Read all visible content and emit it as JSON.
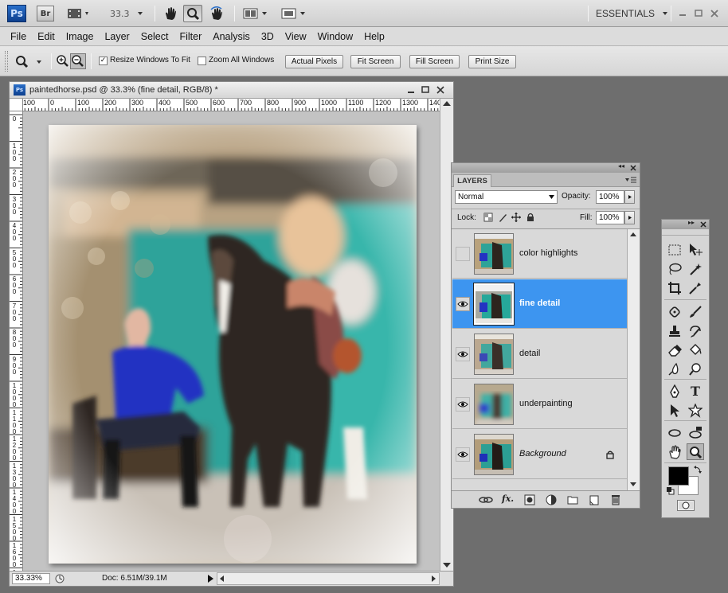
{
  "app": {
    "logo": "Ps",
    "bridge": "Br",
    "zoom_value": "33.3",
    "workspace": "ESSENTIALS",
    "icons": [
      "minimize-icon",
      "maximize-icon",
      "close-icon"
    ]
  },
  "menu": [
    "File",
    "Edit",
    "Image",
    "Layer",
    "Select",
    "Filter",
    "Analysis",
    "3D",
    "View",
    "Window",
    "Help"
  ],
  "options": {
    "resize_label": "Resize Windows To Fit",
    "zoom_all_label": "Zoom All Windows",
    "actual_pixels": "Actual Pixels",
    "fit_screen": "Fit Screen",
    "fill_screen": "Fill Screen",
    "print_size": "Print Size"
  },
  "document": {
    "title": "paintedhorse.psd @ 33.3% (fine detail, RGB/8) *",
    "ruler_h": [
      "100",
      "0",
      "100",
      "200",
      "300",
      "400",
      "500",
      "600",
      "700",
      "800",
      "900",
      "1000",
      "1100",
      "1200",
      "1300",
      "1400"
    ],
    "ruler_v": [
      "0",
      "1 0 0",
      "2 0 0",
      "3 0 0",
      "4 0 0",
      "5 0 0",
      "6 0 0",
      "7 0 0",
      "8 0 0",
      "9 0 0",
      "1 0 0 0",
      "1 1 0 0",
      "1 2 0 0",
      "1 3 0 0",
      "1 4 0 0",
      "1 5 0 0",
      "1 6 0 0",
      "1 7 0 0"
    ],
    "zoom": "33.33%",
    "doc_size": "Doc: 6.51M/39.1M"
  },
  "layers_panel": {
    "tab": "LAYERS",
    "blend_mode": "Normal",
    "opacity_label": "Opacity:",
    "opacity_value": "100%",
    "lock_label": "Lock:",
    "fill_label": "Fill:",
    "fill_value": "100%",
    "layers": [
      {
        "name": "color highlights",
        "visible": false,
        "selected": false
      },
      {
        "name": "fine detail",
        "visible": true,
        "selected": true
      },
      {
        "name": "detail",
        "visible": true,
        "selected": false
      },
      {
        "name": "underpainting",
        "visible": true,
        "selected": false
      },
      {
        "name": "Background",
        "visible": true,
        "selected": false,
        "locked": true
      }
    ]
  },
  "toolbox": {
    "colors": {
      "foreground": "#000000",
      "background": "#ffffff"
    },
    "type_tool_label": "T"
  }
}
